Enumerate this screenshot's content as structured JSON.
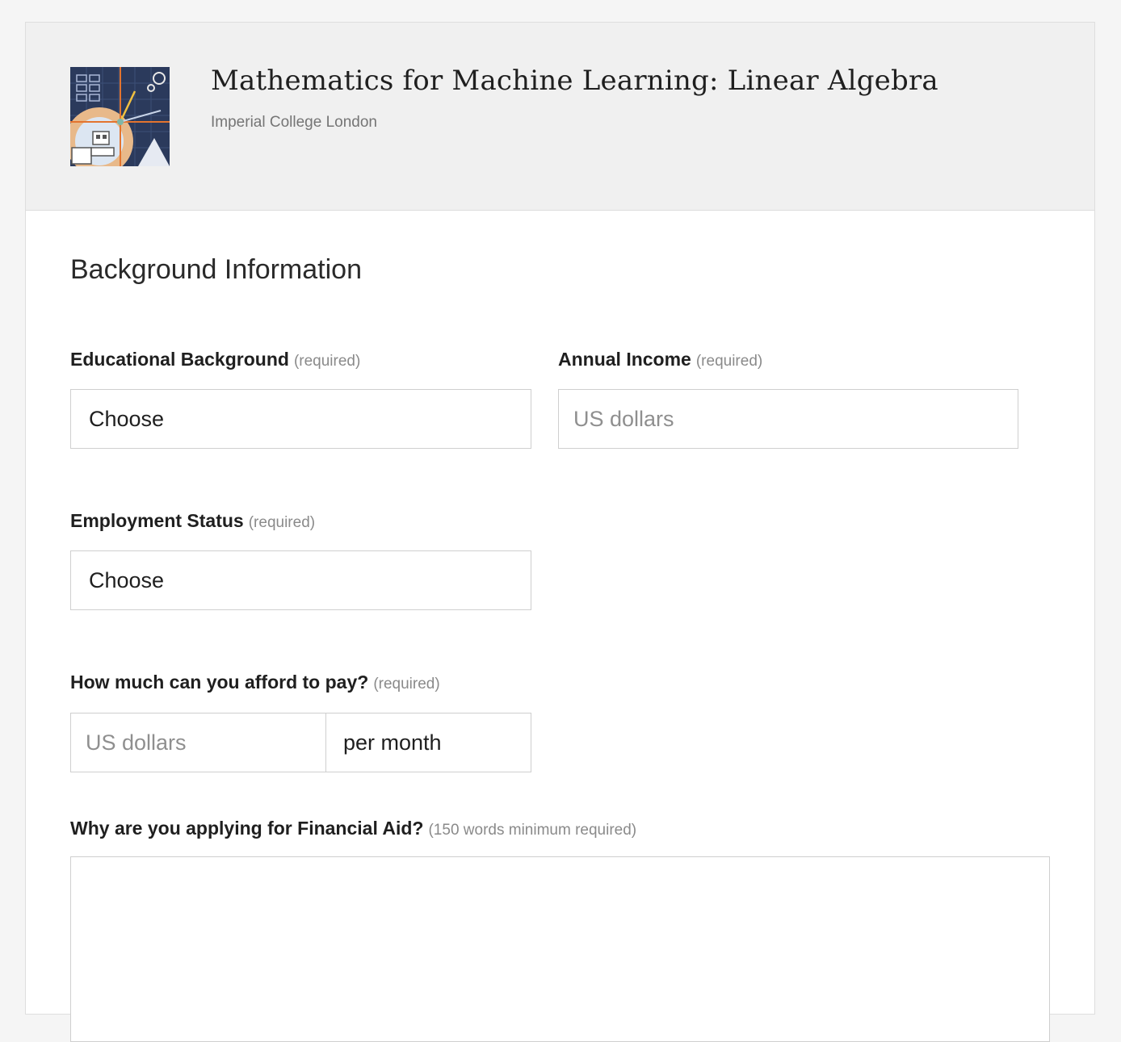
{
  "course": {
    "title": "Mathematics for Machine Learning: Linear Algebra",
    "partner": "Imperial College London",
    "logo_icon": "course-thumbnail-image"
  },
  "form": {
    "section_title": "Background Information",
    "education": {
      "label": "Educational Background",
      "required_note": "(required)",
      "value": "Choose"
    },
    "income": {
      "label": "Annual Income",
      "required_note": "(required)",
      "placeholder": "US dollars"
    },
    "employment": {
      "label": "Employment Status",
      "required_note": "(required)",
      "value": "Choose"
    },
    "afford": {
      "label": "How much can you afford to pay?",
      "required_note": "(required)",
      "placeholder": "US dollars",
      "period": "per month"
    },
    "reason": {
      "label": "Why are you applying for Financial Aid?",
      "required_note": "(150 words minimum required)",
      "value": ""
    }
  },
  "colors": {
    "header_bg": "#f0f0f0",
    "page_bg": "#f5f5f5",
    "border": "#cfcfcf",
    "muted_text": "#8a8a8a",
    "logo_bg": "#2b3a5c",
    "logo_accent": "#e8b98a"
  }
}
